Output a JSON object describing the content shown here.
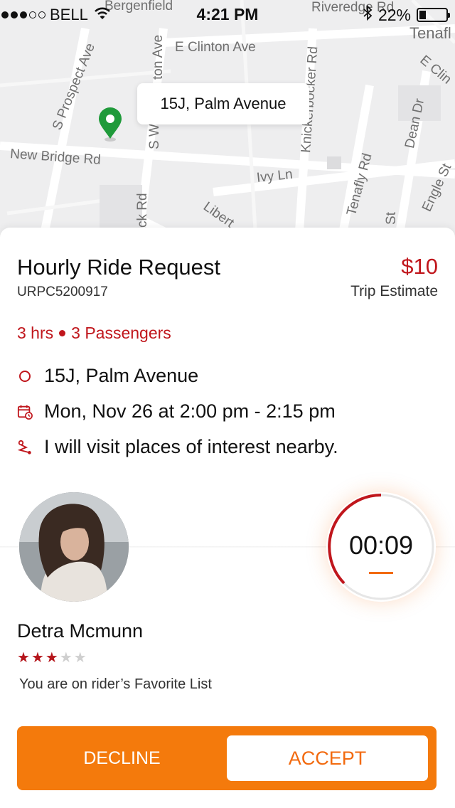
{
  "status_bar": {
    "carrier": "BELL",
    "time": "4:21 PM",
    "battery": "22%",
    "signal_bars_filled": 3,
    "signal_bars_total": 5
  },
  "map": {
    "streets": [
      "Bergenfield",
      "E Clinton Ave",
      "S Prospect Ave",
      "ton Ave",
      "Knickerbocker Rd",
      "Riveredge Rd",
      "Tenafl",
      "E Clin",
      "New Bridge Rd",
      "S W",
      "Dean Dr",
      "Ivy Ln",
      "Tenafly Rd",
      "Engle St",
      "ck Rd",
      "Libert",
      "St"
    ],
    "pin_label": "15J, Palm Avenue"
  },
  "ride": {
    "title": "Hourly Ride Request",
    "code": "URPC5200917",
    "price": "$10",
    "price_caption": "Trip Estimate",
    "duration": "3 hrs",
    "passengers": "3 Passengers",
    "location": "15J, Palm Avenue",
    "schedule": "Mon, Nov 26 at 2:00 pm - 2:15 pm",
    "note": "I will visit places of interest nearby."
  },
  "timer": {
    "value": "00:09"
  },
  "rider": {
    "name": "Detra Mcmunn",
    "rating": 3,
    "rating_max": 5,
    "favorite_text": "You are on rider’s Favorite List"
  },
  "actions": {
    "decline": "DECLINE",
    "accept": "ACCEPT"
  },
  "colors": {
    "accent_red": "#c0161c",
    "accent_orange": "#f47a0c",
    "pin_green": "#1f9a3a"
  }
}
